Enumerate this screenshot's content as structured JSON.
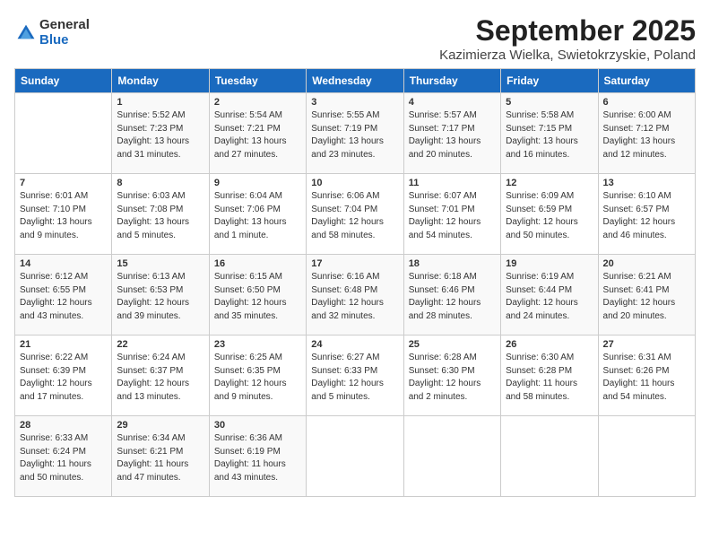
{
  "logo": {
    "general": "General",
    "blue": "Blue"
  },
  "title": "September 2025",
  "location": "Kazimierza Wielka, Swietokrzyskie, Poland",
  "weekdays": [
    "Sunday",
    "Monday",
    "Tuesday",
    "Wednesday",
    "Thursday",
    "Friday",
    "Saturday"
  ],
  "weeks": [
    [
      {
        "day": "",
        "sunrise": "",
        "sunset": "",
        "daylight": ""
      },
      {
        "day": "1",
        "sunrise": "Sunrise: 5:52 AM",
        "sunset": "Sunset: 7:23 PM",
        "daylight": "Daylight: 13 hours and 31 minutes."
      },
      {
        "day": "2",
        "sunrise": "Sunrise: 5:54 AM",
        "sunset": "Sunset: 7:21 PM",
        "daylight": "Daylight: 13 hours and 27 minutes."
      },
      {
        "day": "3",
        "sunrise": "Sunrise: 5:55 AM",
        "sunset": "Sunset: 7:19 PM",
        "daylight": "Daylight: 13 hours and 23 minutes."
      },
      {
        "day": "4",
        "sunrise": "Sunrise: 5:57 AM",
        "sunset": "Sunset: 7:17 PM",
        "daylight": "Daylight: 13 hours and 20 minutes."
      },
      {
        "day": "5",
        "sunrise": "Sunrise: 5:58 AM",
        "sunset": "Sunset: 7:15 PM",
        "daylight": "Daylight: 13 hours and 16 minutes."
      },
      {
        "day": "6",
        "sunrise": "Sunrise: 6:00 AM",
        "sunset": "Sunset: 7:12 PM",
        "daylight": "Daylight: 13 hours and 12 minutes."
      }
    ],
    [
      {
        "day": "7",
        "sunrise": "Sunrise: 6:01 AM",
        "sunset": "Sunset: 7:10 PM",
        "daylight": "Daylight: 13 hours and 9 minutes."
      },
      {
        "day": "8",
        "sunrise": "Sunrise: 6:03 AM",
        "sunset": "Sunset: 7:08 PM",
        "daylight": "Daylight: 13 hours and 5 minutes."
      },
      {
        "day": "9",
        "sunrise": "Sunrise: 6:04 AM",
        "sunset": "Sunset: 7:06 PM",
        "daylight": "Daylight: 13 hours and 1 minute."
      },
      {
        "day": "10",
        "sunrise": "Sunrise: 6:06 AM",
        "sunset": "Sunset: 7:04 PM",
        "daylight": "Daylight: 12 hours and 58 minutes."
      },
      {
        "day": "11",
        "sunrise": "Sunrise: 6:07 AM",
        "sunset": "Sunset: 7:01 PM",
        "daylight": "Daylight: 12 hours and 54 minutes."
      },
      {
        "day": "12",
        "sunrise": "Sunrise: 6:09 AM",
        "sunset": "Sunset: 6:59 PM",
        "daylight": "Daylight: 12 hours and 50 minutes."
      },
      {
        "day": "13",
        "sunrise": "Sunrise: 6:10 AM",
        "sunset": "Sunset: 6:57 PM",
        "daylight": "Daylight: 12 hours and 46 minutes."
      }
    ],
    [
      {
        "day": "14",
        "sunrise": "Sunrise: 6:12 AM",
        "sunset": "Sunset: 6:55 PM",
        "daylight": "Daylight: 12 hours and 43 minutes."
      },
      {
        "day": "15",
        "sunrise": "Sunrise: 6:13 AM",
        "sunset": "Sunset: 6:53 PM",
        "daylight": "Daylight: 12 hours and 39 minutes."
      },
      {
        "day": "16",
        "sunrise": "Sunrise: 6:15 AM",
        "sunset": "Sunset: 6:50 PM",
        "daylight": "Daylight: 12 hours and 35 minutes."
      },
      {
        "day": "17",
        "sunrise": "Sunrise: 6:16 AM",
        "sunset": "Sunset: 6:48 PM",
        "daylight": "Daylight: 12 hours and 32 minutes."
      },
      {
        "day": "18",
        "sunrise": "Sunrise: 6:18 AM",
        "sunset": "Sunset: 6:46 PM",
        "daylight": "Daylight: 12 hours and 28 minutes."
      },
      {
        "day": "19",
        "sunrise": "Sunrise: 6:19 AM",
        "sunset": "Sunset: 6:44 PM",
        "daylight": "Daylight: 12 hours and 24 minutes."
      },
      {
        "day": "20",
        "sunrise": "Sunrise: 6:21 AM",
        "sunset": "Sunset: 6:41 PM",
        "daylight": "Daylight: 12 hours and 20 minutes."
      }
    ],
    [
      {
        "day": "21",
        "sunrise": "Sunrise: 6:22 AM",
        "sunset": "Sunset: 6:39 PM",
        "daylight": "Daylight: 12 hours and 17 minutes."
      },
      {
        "day": "22",
        "sunrise": "Sunrise: 6:24 AM",
        "sunset": "Sunset: 6:37 PM",
        "daylight": "Daylight: 12 hours and 13 minutes."
      },
      {
        "day": "23",
        "sunrise": "Sunrise: 6:25 AM",
        "sunset": "Sunset: 6:35 PM",
        "daylight": "Daylight: 12 hours and 9 minutes."
      },
      {
        "day": "24",
        "sunrise": "Sunrise: 6:27 AM",
        "sunset": "Sunset: 6:33 PM",
        "daylight": "Daylight: 12 hours and 5 minutes."
      },
      {
        "day": "25",
        "sunrise": "Sunrise: 6:28 AM",
        "sunset": "Sunset: 6:30 PM",
        "daylight": "Daylight: 12 hours and 2 minutes."
      },
      {
        "day": "26",
        "sunrise": "Sunrise: 6:30 AM",
        "sunset": "Sunset: 6:28 PM",
        "daylight": "Daylight: 11 hours and 58 minutes."
      },
      {
        "day": "27",
        "sunrise": "Sunrise: 6:31 AM",
        "sunset": "Sunset: 6:26 PM",
        "daylight": "Daylight: 11 hours and 54 minutes."
      }
    ],
    [
      {
        "day": "28",
        "sunrise": "Sunrise: 6:33 AM",
        "sunset": "Sunset: 6:24 PM",
        "daylight": "Daylight: 11 hours and 50 minutes."
      },
      {
        "day": "29",
        "sunrise": "Sunrise: 6:34 AM",
        "sunset": "Sunset: 6:21 PM",
        "daylight": "Daylight: 11 hours and 47 minutes."
      },
      {
        "day": "30",
        "sunrise": "Sunrise: 6:36 AM",
        "sunset": "Sunset: 6:19 PM",
        "daylight": "Daylight: 11 hours and 43 minutes."
      },
      {
        "day": "",
        "sunrise": "",
        "sunset": "",
        "daylight": ""
      },
      {
        "day": "",
        "sunrise": "",
        "sunset": "",
        "daylight": ""
      },
      {
        "day": "",
        "sunrise": "",
        "sunset": "",
        "daylight": ""
      },
      {
        "day": "",
        "sunrise": "",
        "sunset": "",
        "daylight": ""
      }
    ]
  ]
}
